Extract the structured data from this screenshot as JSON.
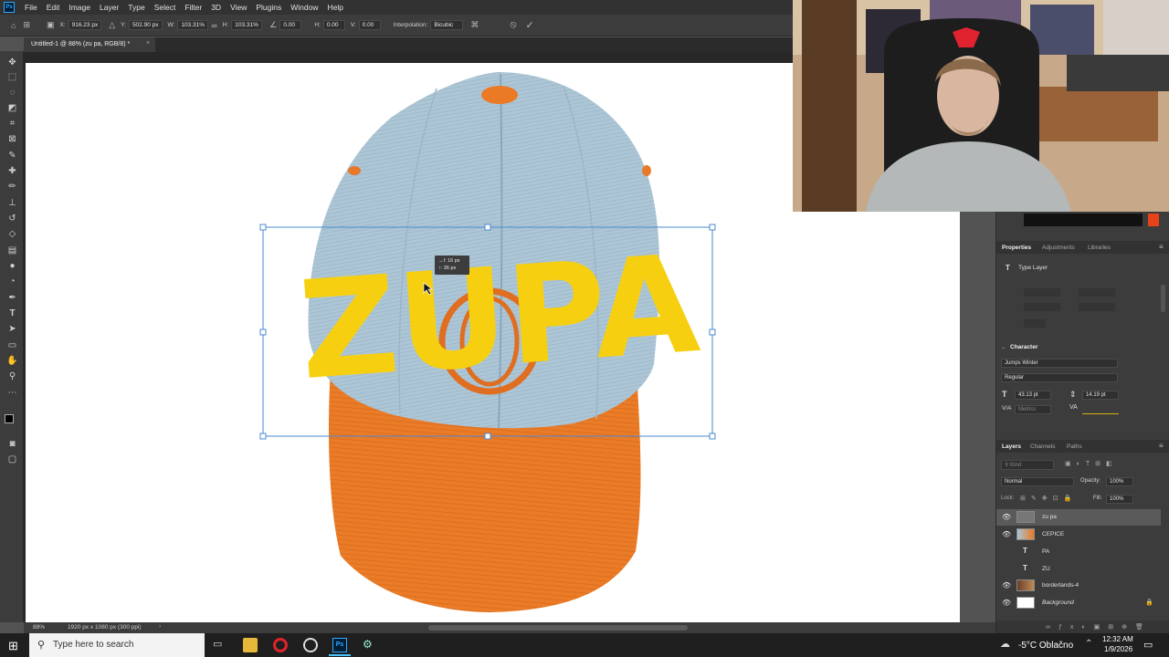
{
  "menubar": {
    "items": [
      "File",
      "Edit",
      "Image",
      "Layer",
      "Type",
      "Select",
      "Filter",
      "3D",
      "View",
      "Plugins",
      "Window",
      "Help"
    ]
  },
  "options": {
    "x_label": "X:",
    "x_value": "916.23 px",
    "y_label": "Y:",
    "y_value": "502.90 px",
    "w_label": "W:",
    "w_value": "103.31%",
    "h_label": "H:",
    "h_value": "103.31%",
    "angle_value": "0.00",
    "hskew_label": "H:",
    "hskew_value": "0.00",
    "vskew_label": "V:",
    "vskew_value": "0.00",
    "interp_label": "Interpolation:",
    "interp_value": "Bicubic"
  },
  "document": {
    "tab_title": "Untitled-1 @ 88% (zu pa, RGB/8) *",
    "artwork_text": "ZUPA",
    "tooltip_line1": "→I: 16 px",
    "tooltip_line2": "↑: 36 px"
  },
  "status": {
    "zoom": "88%",
    "doc_info": "1920 px x 1080 px (300 ppi)"
  },
  "properties": {
    "tabs": [
      "Properties",
      "Adjustments",
      "Libraries"
    ],
    "type_layer_label": "Type Layer",
    "character_label": "Character",
    "font_family": "Jumps Winter",
    "font_style": "Regular",
    "font_size": "43.13 pt",
    "leading": "14.19 pt",
    "kerning": "Metrics"
  },
  "layers": {
    "tabs": [
      "Layers",
      "Channels",
      "Paths"
    ],
    "kind_placeholder": "Kind",
    "blend_mode": "Normal",
    "opacity_label": "Opacity:",
    "opacity_value": "100%",
    "lock_label": "Lock:",
    "fill_label": "Fill:",
    "fill_value": "100%",
    "items": [
      {
        "name": "zu pa"
      },
      {
        "name": "CEPICE"
      },
      {
        "name": "PA"
      },
      {
        "name": "ZU"
      },
      {
        "name": "borderlands-4"
      },
      {
        "name": "Background"
      }
    ]
  },
  "taskbar": {
    "search_placeholder": "Type here to search",
    "weather": "-5°C  Oblačno",
    "time": "12:32 AM",
    "date": "1/9/2026"
  },
  "colors": {
    "cap_blue": "#a9c4d6",
    "cap_orange": "#ea7a25",
    "text_yellow": "#f6d010",
    "ps_blue": "#31a8ff"
  }
}
